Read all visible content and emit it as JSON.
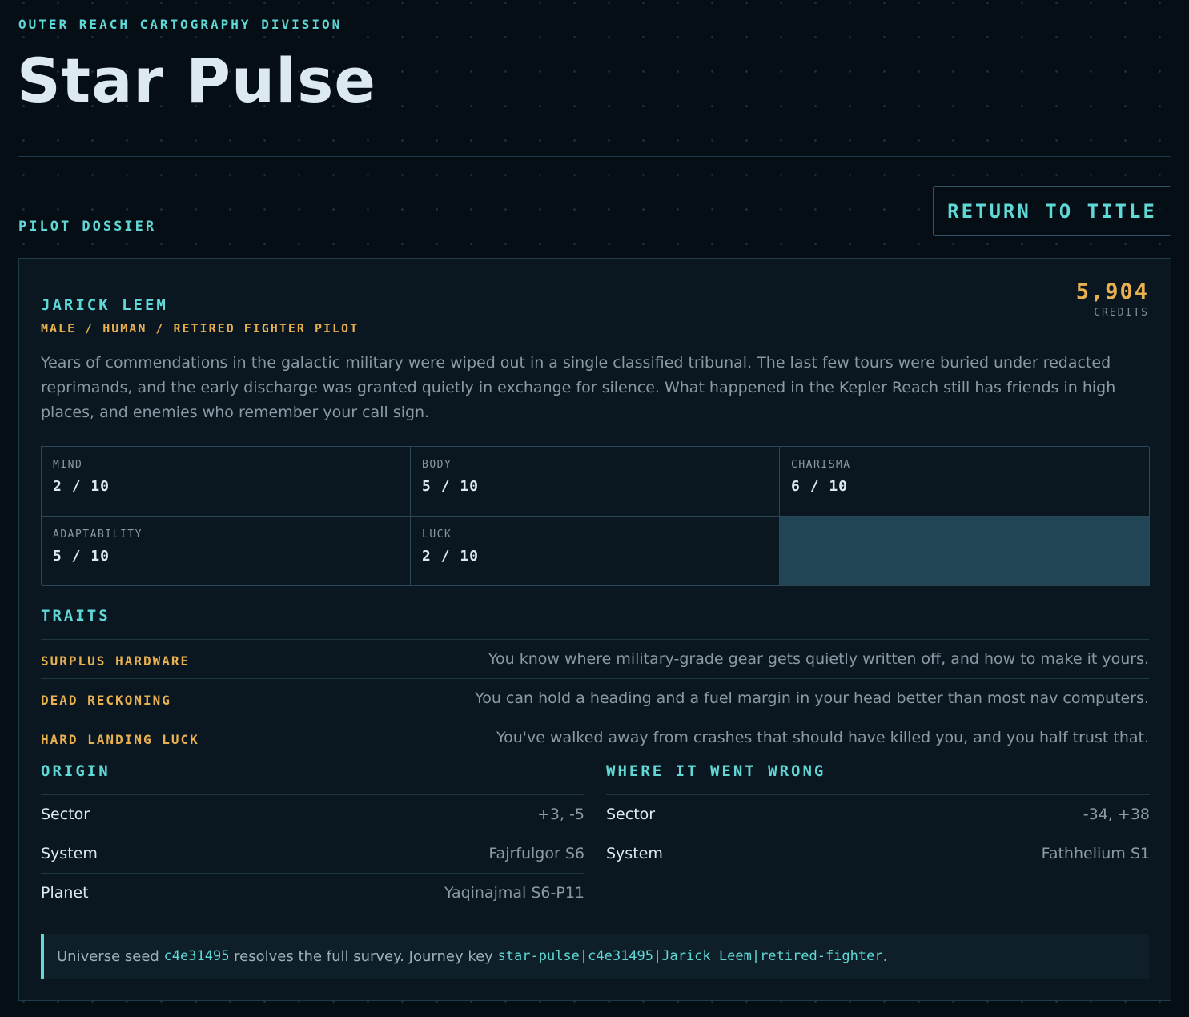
{
  "header": {
    "division": "OUTER REACH CARTOGRAPHY DIVISION",
    "title": "Star Pulse"
  },
  "section_label": "PILOT DOSSIER",
  "return_button": "RETURN TO TITLE",
  "pilot": {
    "name": "JARICK LEEM",
    "subtitle": "MALE / HUMAN / RETIRED FIGHTER PILOT",
    "credits_value": "5,904",
    "credits_label": "CREDITS",
    "bio": "Years of commendations in the galactic military were wiped out in a single classified tribunal. The last few tours were buried under redacted reprimands, and the early discharge was granted quietly in exchange for silence. What happened in the Kepler Reach still has friends in high places, and enemies who remember your call sign."
  },
  "stats": [
    {
      "label": "MIND",
      "value": "2 / 10"
    },
    {
      "label": "BODY",
      "value": "5 / 10"
    },
    {
      "label": "CHARISMA",
      "value": "6 / 10"
    },
    {
      "label": "ADAPTABILITY",
      "value": "5 / 10"
    },
    {
      "label": "LUCK",
      "value": "2 / 10"
    }
  ],
  "traits": {
    "heading": "TRAITS",
    "items": [
      {
        "name": "SURPLUS HARDWARE",
        "desc": "You know where military-grade gear gets quietly written off, and how to make it yours."
      },
      {
        "name": "DEAD RECKONING",
        "desc": "You can hold a heading and a fuel margin in your head better than most nav computers."
      },
      {
        "name": "HARD LANDING LUCK",
        "desc": "You've walked away from crashes that should have killed you, and you half trust that."
      }
    ]
  },
  "origin": {
    "heading": "ORIGIN",
    "rows": [
      {
        "key": "Sector",
        "value": "+3, -5"
      },
      {
        "key": "System",
        "value": "Fajrfulgor S6"
      },
      {
        "key": "Planet",
        "value": "Yaqinajmal S6-P11"
      }
    ]
  },
  "wrong": {
    "heading": "WHERE IT WENT WRONG",
    "rows": [
      {
        "key": "Sector",
        "value": "-34, +38"
      },
      {
        "key": "System",
        "value": "Fathhelium S1"
      }
    ]
  },
  "seed": {
    "prefix": "Universe seed ",
    "seed_code": "c4e31495",
    "middle": " resolves the full survey. Journey key ",
    "journey_key": "star-pulse|c4e31495|Jarick Leem|retired-fighter",
    "suffix": "."
  },
  "colors": {
    "accent": "#5fd8d6",
    "gold": "#e9b04f",
    "background": "#050d15",
    "card": "#0a1721"
  }
}
